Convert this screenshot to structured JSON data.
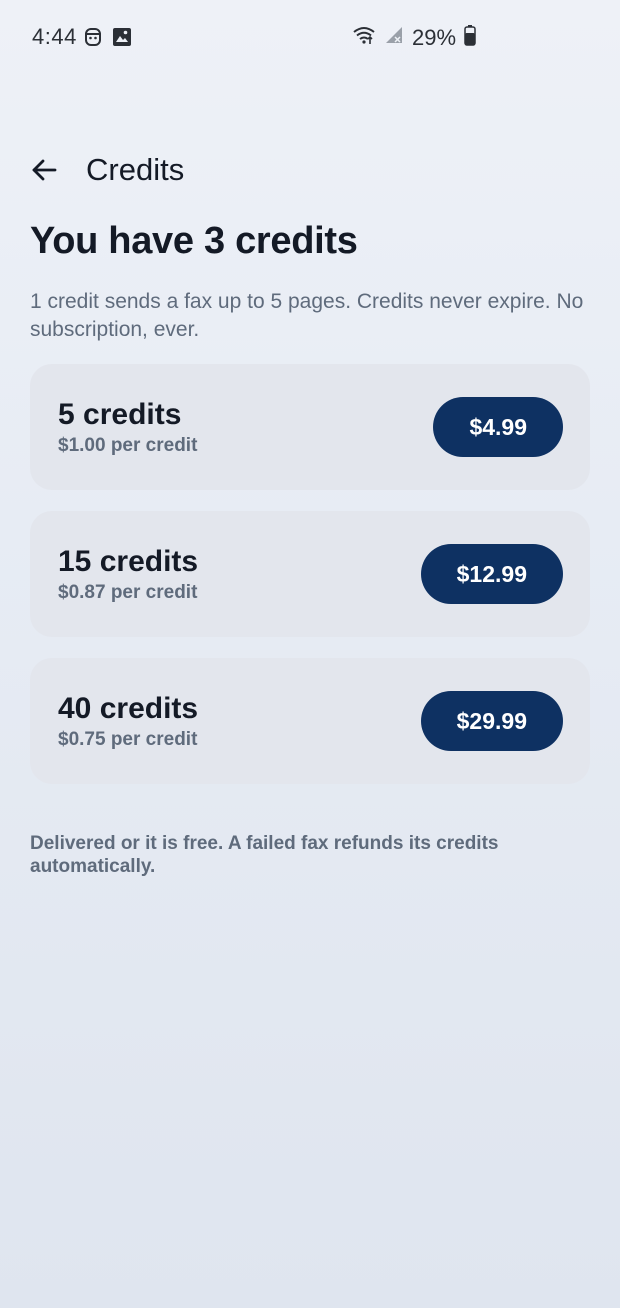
{
  "status_bar": {
    "time": "4:44",
    "battery": "29%",
    "icons": [
      "face-icon",
      "image-icon",
      "wifi-icon",
      "signal-icon",
      "battery-icon"
    ]
  },
  "app_bar": {
    "title": "Credits"
  },
  "balance": {
    "heading": "You have 3 credits",
    "description": "1 credit sends a fax up to 5 pages. Credits never expire. No subscription, ever."
  },
  "packs": [
    {
      "name": "5 credits",
      "rate": "$1.00 per credit",
      "price": "$4.99"
    },
    {
      "name": "15 credits",
      "rate": "$0.87 per credit",
      "price": "$12.99"
    },
    {
      "name": "40 credits",
      "rate": "$0.75 per credit",
      "price": "$29.99"
    }
  ],
  "footer_note": "Delivered or it is free. A failed fax refunds its credits automatically.",
  "colors": {
    "button_bg": "#0e3162",
    "card_bg": "#e3e6ed",
    "muted_text": "#5f6b7c"
  }
}
